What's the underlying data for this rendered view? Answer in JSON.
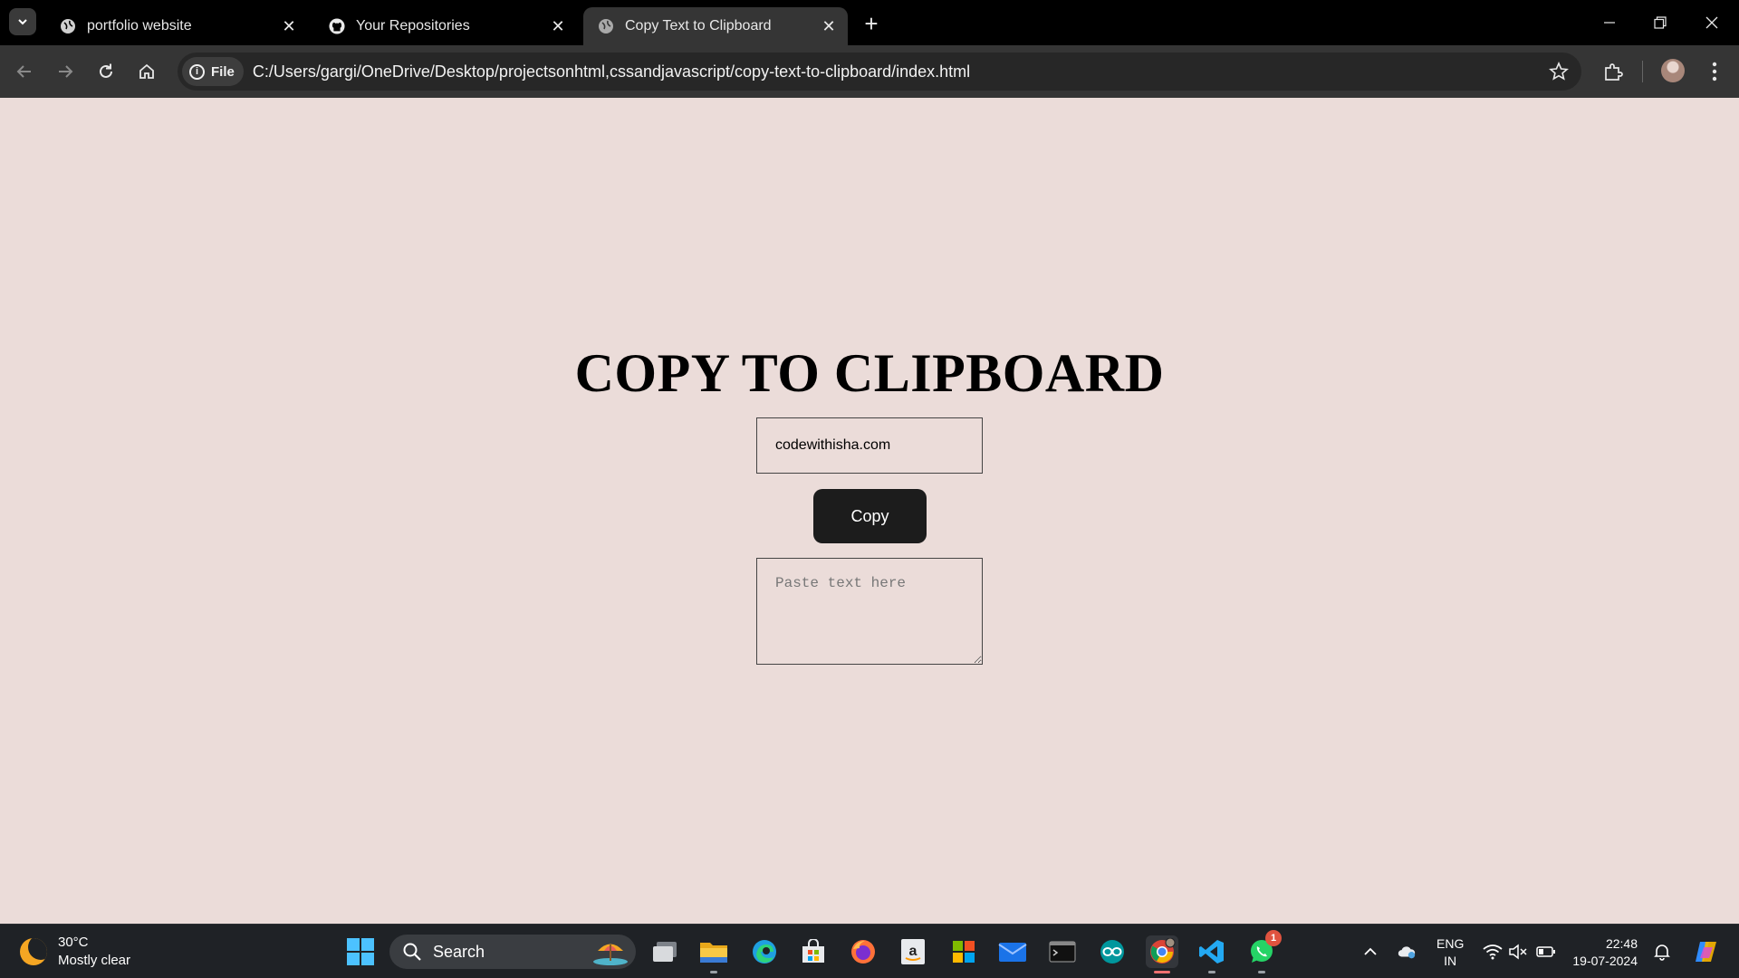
{
  "browser": {
    "tabs": [
      {
        "title": "portfolio website",
        "favicon": "globe-icon",
        "active": false
      },
      {
        "title": "Your Repositories",
        "favicon": "github-icon",
        "active": false
      },
      {
        "title": "Copy Text to Clipboard",
        "favicon": "globe-icon",
        "active": true
      }
    ],
    "address_chip": "File",
    "url": "C:/Users/gargi/OneDrive/Desktop/projectsonhtml,cssandjavascript/copy-text-to-clipboard/index.html"
  },
  "page": {
    "heading": "COPY TO CLIPBOARD",
    "input_value": "codewithisha.com",
    "copy_button": "Copy",
    "paste_placeholder": "Paste text here",
    "background_color": "#ebdcd9",
    "button_color": "#1c1c1c"
  },
  "taskbar": {
    "weather_temp": "30°C",
    "weather_desc": "Mostly clear",
    "search_label": "Search",
    "whatsapp_badge": "1",
    "lang_line1": "ENG",
    "lang_line2": "IN",
    "time": "22:48",
    "date": "19-07-2024"
  }
}
